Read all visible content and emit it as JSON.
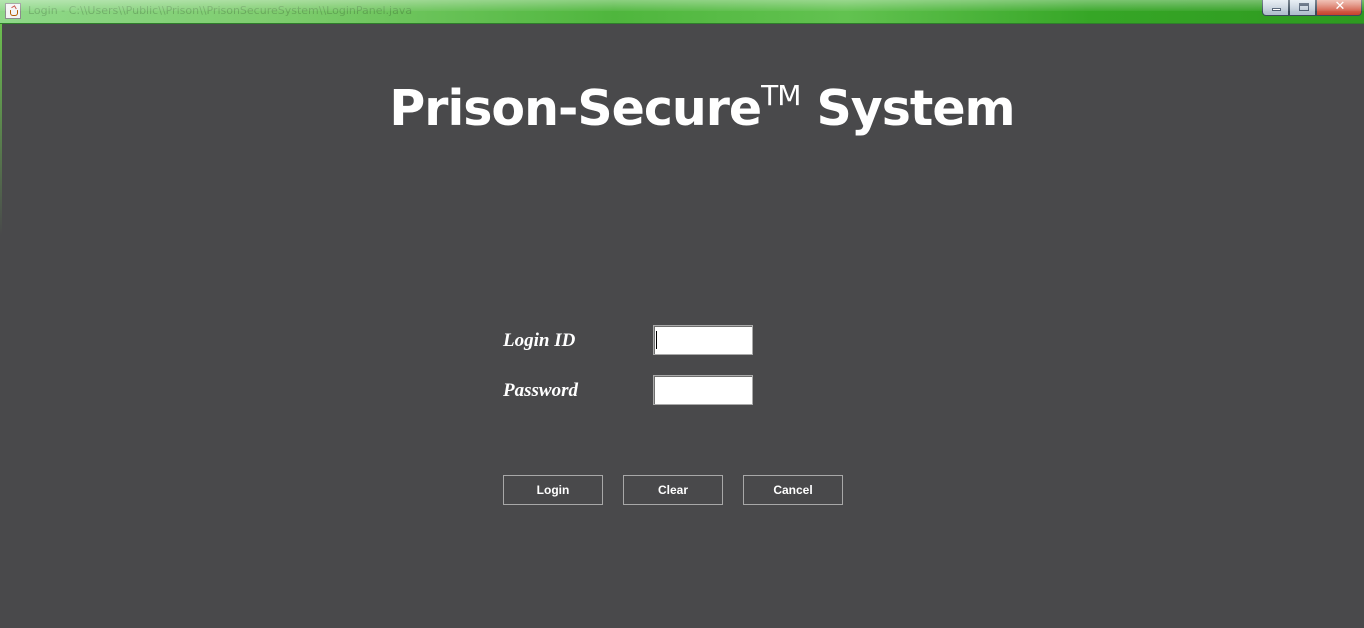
{
  "window": {
    "title": "Login - C:\\\\Users\\\\Public\\\\Prison\\\\PrisonSecureSystem\\\\LoginPanel.java",
    "controls": {
      "minimize": "minimize-icon",
      "maximize": "maximize-icon",
      "close": "✕"
    },
    "app_icon": "java-cup-icon",
    "accent_color": "#4fb63d"
  },
  "heading": {
    "name": "Prison-Secure",
    "trademark": "TM",
    "suffix": " System"
  },
  "form": {
    "login_id_label": "Login ID",
    "login_id_value": "",
    "password_label": "Password",
    "password_value": ""
  },
  "buttons": {
    "login": "Login",
    "clear": "Clear",
    "cancel": "Cancel"
  },
  "colors": {
    "background": "#49494b",
    "text": "#ffffff"
  }
}
